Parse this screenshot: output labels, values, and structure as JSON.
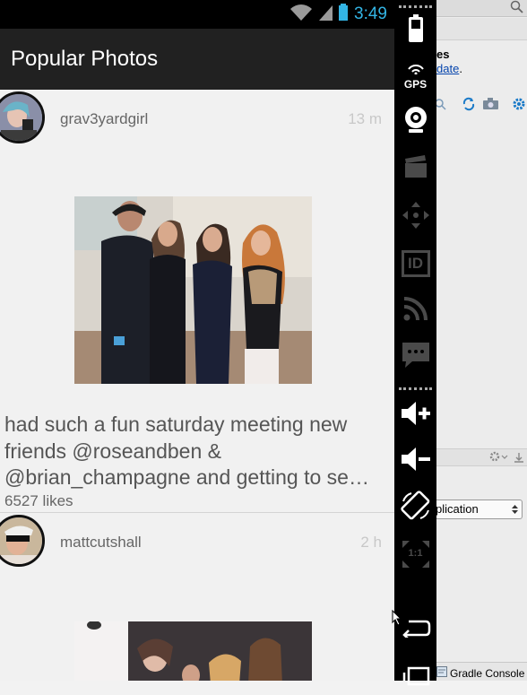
{
  "status_bar": {
    "time": "3:49"
  },
  "action_bar": {
    "title": "Popular Photos"
  },
  "posts": [
    {
      "username": "grav3yardgirl",
      "time": "13 m",
      "caption_lines": [
        "had such a fun saturday meeting new",
        "friends @roseandben &",
        "@brian_champagne and getting to se…"
      ],
      "likes": "6527 likes"
    },
    {
      "username": "mattcutshall",
      "time": "2 h"
    }
  ],
  "emulator_controls": {
    "gps_label": "GPS",
    "id_label": "ID",
    "scale_label": "1:1"
  },
  "ide": {
    "header_fragment": "es",
    "link_fragment": "date",
    "link_suffix": ".",
    "dropdown_value": "plication",
    "tab_label": "Gradle Console"
  },
  "colors": {
    "status_time": "#33b5e5",
    "action_bar": "#212121",
    "ide_link": "#0645ad"
  }
}
